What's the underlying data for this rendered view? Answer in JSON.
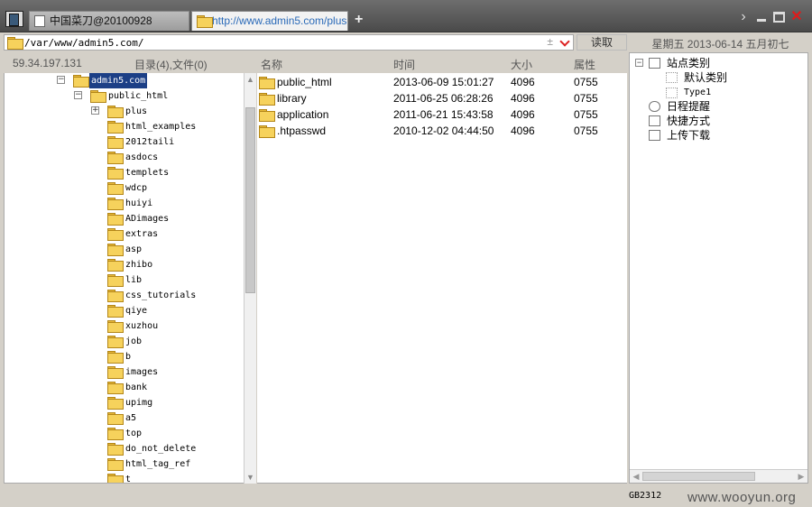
{
  "tabs": [
    {
      "title": "中国菜刀@20100928",
      "active": false
    },
    {
      "title": "http://www.admin5.com/plus...",
      "active": true
    }
  ],
  "new_tab_label": "+",
  "address": {
    "path": "/var/www/admin5.com/",
    "add_symbol": "±",
    "read_button": "读取"
  },
  "date_display": "星期五 2013-06-14 五月初七",
  "server_info": {
    "ip": "59.34.197.131",
    "counts": "目录(4),文件(0)"
  },
  "tree": {
    "root": "admin5.com",
    "child": "public_html",
    "folders": [
      "plus",
      "html_examples",
      "2012taili",
      "asdocs",
      "templets",
      "wdcp",
      "huiyi",
      "ADimages",
      "extras",
      "asp",
      "zhibo",
      "lib",
      "css_tutorials",
      "qiye",
      "xuzhou",
      "job",
      "b",
      "images",
      "bank",
      "upimg",
      "a5",
      "top",
      "do_not_delete",
      "html_tag_ref",
      "t"
    ]
  },
  "file_list": {
    "headers": {
      "name": "名称",
      "time": "时间",
      "size": "大小",
      "attr": "属性"
    },
    "rows": [
      {
        "name": "public_html",
        "time": "2013-06-09 15:01:27",
        "size": "4096",
        "attr": "0755"
      },
      {
        "name": "library",
        "time": "2011-06-25 06:28:26",
        "size": "4096",
        "attr": "0755"
      },
      {
        "name": "application",
        "time": "2011-06-21 15:43:58",
        "size": "4096",
        "attr": "0755"
      },
      {
        "name": ".htpasswd",
        "time": "2010-12-02 04:44:50",
        "size": "4096",
        "attr": "0755"
      }
    ]
  },
  "side_panel": {
    "site_category": "站点类别",
    "default_category": "默认类别",
    "type1": "Type1",
    "schedule": "日程提醒",
    "shortcut": "快捷方式",
    "transfer": "上传下载"
  },
  "status": {
    "encoding": "GB2312",
    "watermark": "www.wooyun.org"
  }
}
